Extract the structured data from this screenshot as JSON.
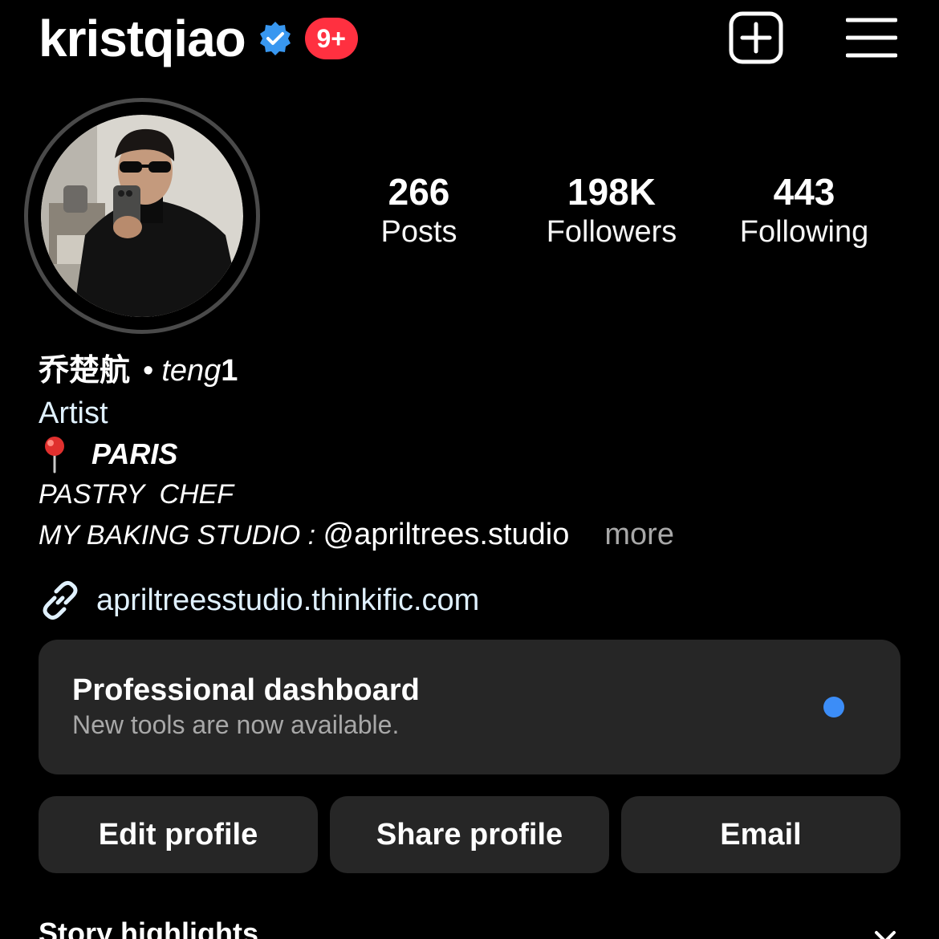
{
  "header": {
    "username": "kristqiao",
    "notification_badge": "9+",
    "verified_icon": "verified-badge-icon",
    "new_post_icon": "plus-square-icon",
    "menu_icon": "hamburger-menu-icon"
  },
  "profile": {
    "avatar_icon": "profile-photo",
    "stats": [
      {
        "count": "266",
        "label": "Posts"
      },
      {
        "count": "198K",
        "label": "Followers"
      },
      {
        "count": "443",
        "label": "Following"
      }
    ]
  },
  "bio": {
    "display_name": "乔楚航",
    "separator": "•",
    "handle_italic": "teng",
    "handle_bold": "1",
    "category": "Artist",
    "location": "PARIS",
    "line1": "PASTRY  CHEF",
    "line2_prefix": "MY BAKING STUDIO : ",
    "mention": "@apriltrees.studio",
    "more": "more",
    "link": "apriltreesstudio.thinkific.com"
  },
  "dashboard": {
    "title": "Professional dashboard",
    "subtitle": "New tools are now available."
  },
  "actions": {
    "edit": "Edit profile",
    "share": "Share profile",
    "email": "Email"
  },
  "highlights": {
    "title": "Story highlights"
  },
  "colors": {
    "background": "#000000",
    "badge": "#ff3040",
    "verified": "#3897f0",
    "button_bg": "#262626",
    "accent_dot": "#3c8df7"
  }
}
